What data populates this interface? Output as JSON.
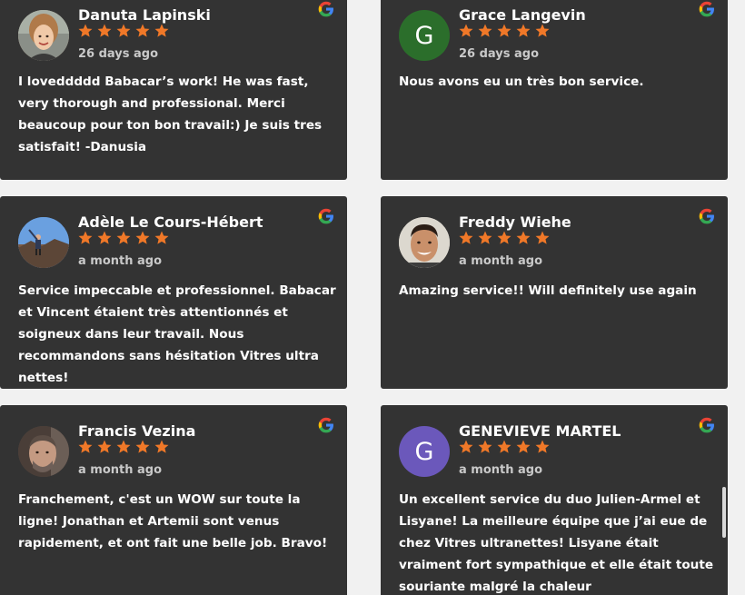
{
  "colors": {
    "card_bg": "#333333",
    "star": "#f07828",
    "avatar_grace": "#2b6e2b",
    "avatar_genevieve": "#6b58bb"
  },
  "reviews": [
    {
      "name": "Danuta Lapinski",
      "date": "26 days ago",
      "rating": 5,
      "avatar": "photo",
      "text": "I loveddddd Babacar’s work! He was fast, very thorough and professional. Merci beaucoup pour ton bon travail:) Je suis tres satisfait! -Danusia"
    },
    {
      "name": "Grace Langevin",
      "date": "26 days ago",
      "rating": 5,
      "avatar_letter": "G",
      "text": "Nous avons eu un très bon service."
    },
    {
      "name": "Adèle Le Cours-Hébert",
      "date": "a month ago",
      "rating": 5,
      "avatar": "photo",
      "text": "Service impeccable et professionnel. Babacar et Vincent étaient très attentionnés et soigneux dans leur travail. Nous recommandons sans hésitation Vitres ultra nettes!"
    },
    {
      "name": "Freddy Wiehe",
      "date": "a month ago",
      "rating": 5,
      "avatar": "photo",
      "text": "Amazing service!! Will definitely use again"
    },
    {
      "name": "Francis Vezina",
      "date": "a month ago",
      "rating": 5,
      "avatar": "photo",
      "text": "Franchement, c'est un WOW sur toute la ligne! Jonathan et Artemii sont venus rapidement, et ont fait une belle job. Bravo!"
    },
    {
      "name": "GENEVIEVE MARTEL",
      "date": "a month ago",
      "rating": 5,
      "avatar_letter": "G",
      "text": "Un excellent service du duo Julien-Armel et Lisyane! La meilleure équipe que j’ai eue de chez Vitres ultranettes! Lisyane était vraiment fort sympathique et elle était toute souriante malgré la chaleur"
    }
  ],
  "icons": {
    "source": "google-g-icon",
    "star": "star-icon"
  }
}
